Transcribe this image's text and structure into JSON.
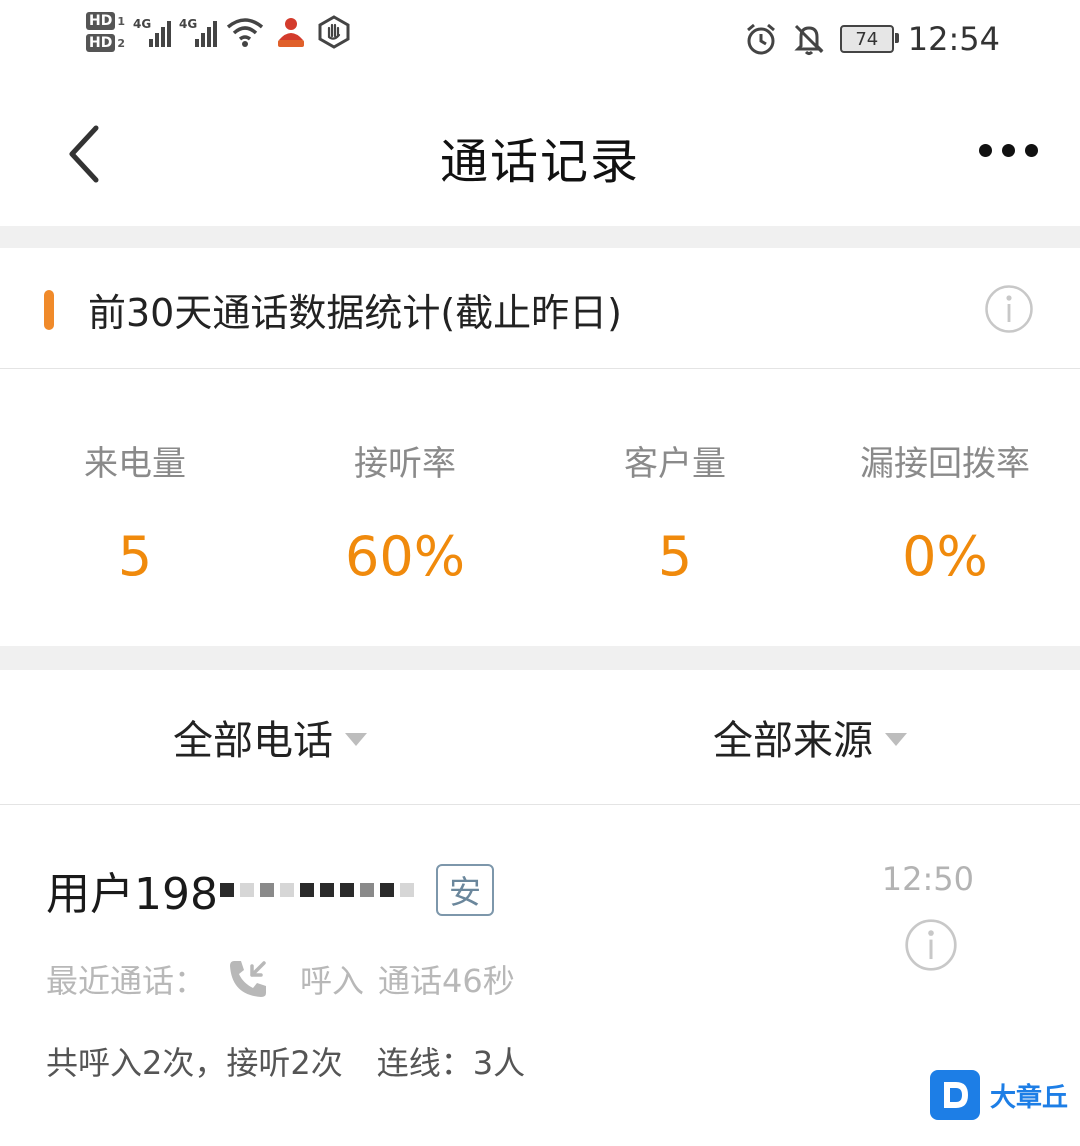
{
  "status_bar": {
    "sim1": "HD",
    "sim1_num": "1",
    "sim2": "HD",
    "sim2_num": "2",
    "net1": "4G",
    "net2": "4G",
    "battery": "74",
    "time": "12:54",
    "icons": [
      "wifi-icon",
      "app-notification-icon",
      "hand-icon",
      "alarm-icon",
      "mute-icon"
    ]
  },
  "nav": {
    "title": "通话记录"
  },
  "stats": {
    "title": "前30天通话数据统计(截止昨日)",
    "accent_color": "#f08a2a",
    "value_color": "#f08a0c",
    "items": [
      {
        "label": "来电量",
        "value": "5"
      },
      {
        "label": "接听率",
        "value": "60%"
      },
      {
        "label": "客户量",
        "value": "5"
      },
      {
        "label": "漏接回拨率",
        "value": "0%"
      }
    ]
  },
  "filters": {
    "call_type": "全部电话",
    "source": "全部来源"
  },
  "record": {
    "name": "用户198",
    "tag": "安",
    "time": "12:50",
    "recent_label": "最近通话：",
    "recent_direction": "呼入",
    "recent_duration": "通话46秒",
    "summary": "共呼入2次，接听2次",
    "connections": "连线：3人"
  },
  "watermark": {
    "logo_letter": "D",
    "text": "大章丘"
  }
}
